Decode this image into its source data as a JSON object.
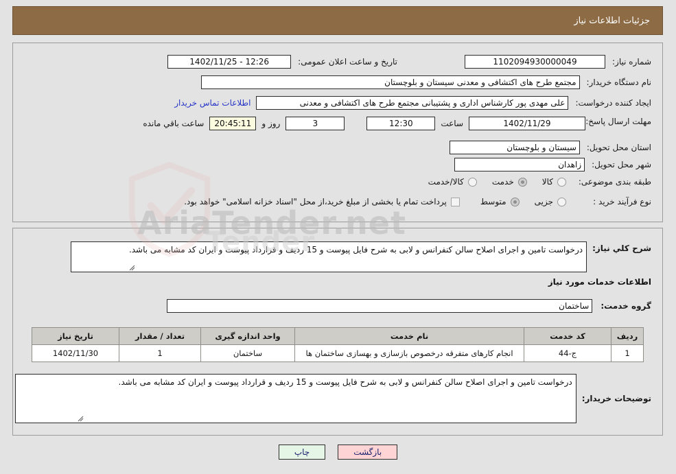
{
  "header": {
    "title": "جزئیات اطلاعات نیاز"
  },
  "colors": {
    "header_bg": "#8d6c45",
    "page_bg": "#e3e3e3",
    "link": "#2735c7",
    "highlight_yellow": "#fbfbdf",
    "button_back_bg": "#ffd4d4",
    "button_print_bg": "#e6f6e6",
    "table_header_bg": "#cfcdc7"
  },
  "top_panel": {
    "need_number": {
      "label": "شماره نیاز:",
      "value": "1102094930000049"
    },
    "announce_datetime": {
      "label": "تاریخ و ساعت اعلان عمومی:",
      "value": "12:26 - 1402/11/25"
    },
    "buyer_org": {
      "label": "نام دستگاه خریدار:",
      "value": "مجتمع طرح های اکتشافی و معدنی سیستان و بلوچستان"
    },
    "requester": {
      "label": "ایجاد کننده درخواست:",
      "value": "علی مهدی پور کارشناس اداری و پشتیبانی مجتمع طرح های اکتشافی و معدنی",
      "contact_link": "اطلاعات تماس خریدار"
    },
    "deadline": {
      "label": "مهلت ارسال پاسخ: تا تاریخ:",
      "date": "1402/11/29",
      "time_label": "ساعت",
      "time": "12:30",
      "days": "3",
      "days_label": "روز و",
      "countdown": "20:45:11",
      "countdown_label": "ساعت باقي مانده"
    },
    "delivery_province": {
      "label": "استان محل تحویل:",
      "value": "سیستان و بلوچستان"
    },
    "delivery_city": {
      "label": "شهر محل تحویل:",
      "value": "زاهدان"
    },
    "subject_category": {
      "label": "طبقه بندی موضوعی:",
      "options": [
        {
          "label": "کالا",
          "selected": false
        },
        {
          "label": "خدمت",
          "selected": true
        },
        {
          "label": "کالا/خدمت",
          "selected": false
        }
      ]
    },
    "purchase_process": {
      "label": "نوع فرآیند خرید :",
      "options": [
        {
          "label": "جزیی",
          "selected": false
        },
        {
          "label": "متوسط",
          "selected": true
        }
      ],
      "treasury_note": "پرداخت تمام یا بخشی از مبلغ خرید،از محل \"اسناد خزانه اسلامی\" خواهد بود.",
      "treasury_checked": false
    }
  },
  "bottom_panel": {
    "general_description": {
      "label": "شرح کلي نیاز:",
      "value": "درخواست تامین و اجرای اصلاح سالن کنفرانس و لابی به شرح فایل پیوست و 15 ردیف و قرارداد پیوست و ایران کد مشابه می باشد."
    },
    "services_section_title": "اطلاعات خدمات مورد نیاز",
    "service_group": {
      "label": "گروه خدمت:",
      "value": "ساختمان"
    },
    "table": {
      "columns": [
        "ردیف",
        "کد خدمت",
        "نام خدمت",
        "واحد اندازه گیری",
        "تعداد / مقدار",
        "تاریخ نیاز"
      ],
      "rows": [
        {
          "row": "1",
          "service_code": "ج-44",
          "service_name": "انجام کارهای متفرقه درخصوص بازسازی و بهسازی ساختمان ها",
          "unit": "ساختمان",
          "quantity": "1",
          "need_date": "1402/11/30"
        }
      ]
    },
    "buyer_notes": {
      "label": "توضیحات خریدار:",
      "value": "درخواست تامین و اجرای اصلاح سالن کنفرانس و لابی به شرح فایل پیوست و 15 ردیف و قرارداد پیوست و ایران کد مشابه می باشد."
    }
  },
  "buttons": {
    "print": "چاپ",
    "back": "بازگشت"
  }
}
